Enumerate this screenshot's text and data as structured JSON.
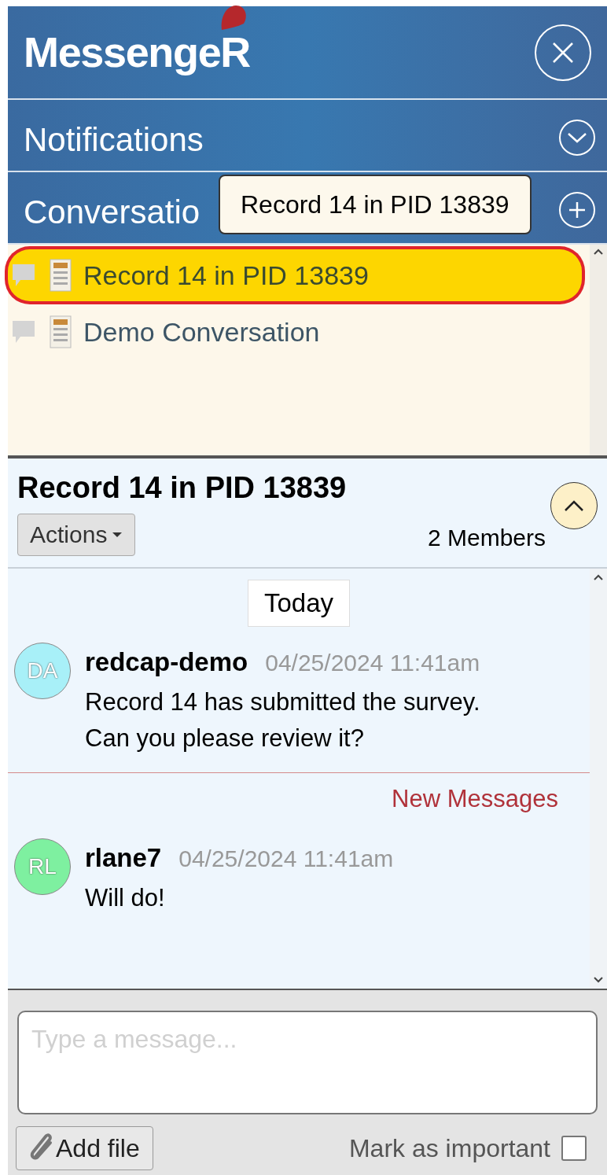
{
  "header": {
    "logo": "MessengeR"
  },
  "sections": [
    {
      "title": "Notifications",
      "kind": "collapse"
    },
    {
      "title": "Conversatio",
      "kind": "add"
    }
  ],
  "tooltip": "Record 14 in PID 13839",
  "conversations": [
    {
      "title": "Record 14 in PID 13839",
      "selected": true,
      "annotated": true
    },
    {
      "title": "Demo Conversation",
      "selected": false,
      "annotated": false
    }
  ],
  "conversation": {
    "title": "Record 14 in PID 13839",
    "actions": "Actions",
    "members": "2 Members"
  },
  "date_label": "Today",
  "messages": [
    {
      "kind": "message",
      "initials": "DA",
      "color": "#a8f0f8",
      "author": "redcap-demo",
      "time": "04/25/2024 11:41am",
      "text": "Record 14 has submitted the survey. Can you please review it?"
    },
    {
      "kind": "divider",
      "text": "New Messages"
    },
    {
      "kind": "message",
      "initials": "RL",
      "color": "#7ef0a0",
      "author": "rlane7",
      "time": "04/25/2024 11:41am",
      "text": "Will do!"
    }
  ],
  "composer": {
    "placeholder": "Type a message...",
    "add_file": "Add file",
    "important_label": "Mark as important",
    "important": false
  }
}
